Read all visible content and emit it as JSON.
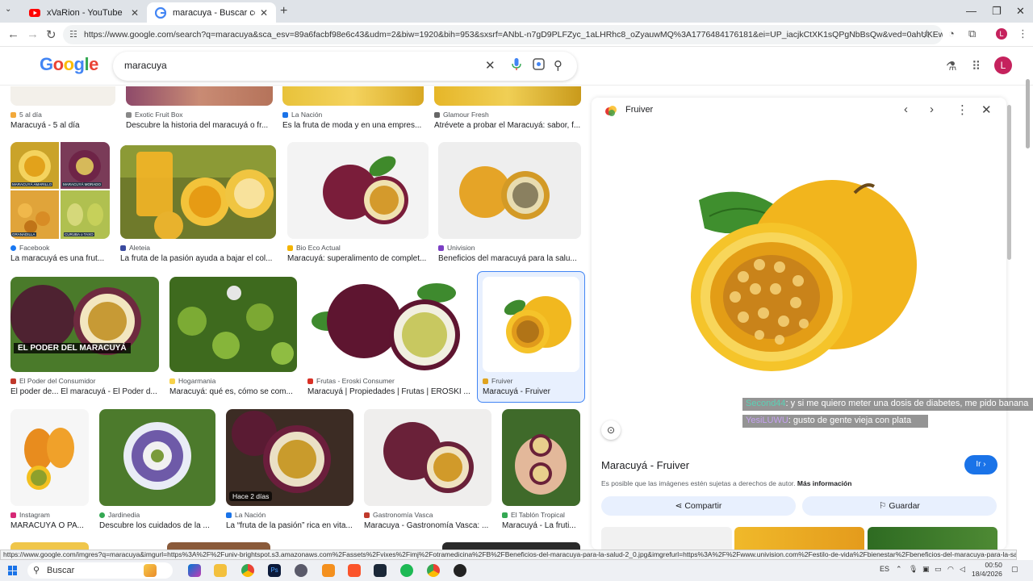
{
  "browser": {
    "tabs": [
      {
        "title": "xVaRion - YouTube",
        "active": false
      },
      {
        "title": "maracuya - Buscar con Google",
        "active": true
      }
    ],
    "new_tab": "+",
    "url": "https://www.google.com/search?q=maracuya&sca_esv=89a6facbf98e6c43&udm=2&biw=1920&bih=953&sxsrf=ANbL-n7gD9PLFZyc_1aLHRhc8_oZyauwMQ%3A1776484176181&ei=UP_iacjkCtXK1sQPgNbBsQw&ved=0ahUKEwjIzJSiv_aTAxVVpZUCH...",
    "profile_letter": "L"
  },
  "google": {
    "search_query": "maracuya",
    "avatar_letter": "L"
  },
  "results": [
    {
      "source": "5 al día",
      "caption": "Maracuyá - 5 al día",
      "color": "#f2a93b"
    },
    {
      "source": "Exotic Fruit Box",
      "caption": "Descubre la historia del maracuyá o fr...",
      "color": "#888"
    },
    {
      "source": "La Nación",
      "caption": "Es la fruta de moda y en una empres...",
      "color": "#1a73e8"
    },
    {
      "source": "Glamour Fresh",
      "caption": "Atrévete a probar el Maracuyá: sabor, f...",
      "color": "#666"
    },
    {
      "source": "Facebook",
      "caption": "La maracuyá es una frut...",
      "color": "#1877f2"
    },
    {
      "source": "Aleteia",
      "caption": "La fruta de la pasión ayuda a bajar el col...",
      "color": "#3a4a9f"
    },
    {
      "source": "Bio Eco Actual",
      "caption": "Maracuyá: superalimento de complet...",
      "color": "#f4b400"
    },
    {
      "source": "Univision",
      "caption": "Beneficios del maracuyá para la salu...",
      "color": "#7b3fc4"
    },
    {
      "source": "El Poder del Consumidor",
      "caption": "El poder de... El maracuyá - El Poder d...",
      "color": "#c0392b"
    },
    {
      "source": "Hogarmania",
      "caption": "Maracuyá: qué es, cómo se com...",
      "color": "#f7d24a"
    },
    {
      "source": "Frutas - Eroski Consumer",
      "caption": "Maracuyá | Propiedades | Frutas | EROSKI ...",
      "color": "#d93025"
    },
    {
      "source": "Fruiver",
      "caption": "Maracuyá - Fruiver",
      "color": "#e0a420"
    },
    {
      "source": "Instagram",
      "caption": "MARACUYÁ O PA...",
      "color": "#d62976"
    },
    {
      "source": "Jardinedia",
      "caption": "Descubre los cuidados de la ...",
      "color": "#34a853"
    },
    {
      "source": "La Nación",
      "caption": "La “fruta de la pasión” rica en vita...",
      "color": "#1a73e8"
    },
    {
      "source": "Gastronomía Vasca",
      "caption": "Maracuya - Gastronomía Vasca: ...",
      "color": "#c0392b"
    },
    {
      "source": "El Tablón Tropical",
      "caption": "Maracuyá - La fruti...",
      "color": "#34a853"
    }
  ],
  "overlays": {
    "facebook_img_labels": [
      "MARACUYÁ AMARILLO",
      "MARACUYÁ MORADO",
      "GRANADILLA",
      "CURUBA o TAXO"
    ],
    "poder_label": "EL PODER DEL MARACUYÁ",
    "time_badge": "Hace 2 días"
  },
  "panel": {
    "source": "Fruiver",
    "title": "Maracuyá - Fruiver",
    "go_label": "Ir",
    "copyright": "Es posible que las imágenes estén sujetas a derechos de autor.",
    "more_info": "Más información",
    "share_label": "Compartir",
    "save_label": "Guardar"
  },
  "chat": [
    {
      "user": "Second44",
      "msg": ": y si me quiero meter una dosis de diabetes, me pido banana"
    },
    {
      "user": "YesiLUWU",
      "msg": ": gusto de gente vieja con plata"
    }
  ],
  "status_url": "https://www.google.com/imgres?q=maracuya&imgurl=https%3A%2F%2Funiv-brightspot.s3.amazonaws.com%2Fassets%2Fvixes%2Fimj%2Fotramedicina%2FB%2FBeneficios-del-maracuya-para-la-salud-2_0.jpg&imgrefurl=https%3A%2F%2Fwww.univision.com%2Festilo-de-vida%2Fbienestar%2Fbeneficios-del-maracuya-para-la-salud&docid=Mhe3wgRO...",
  "taskbar": {
    "search_label": "Buscar",
    "lang": "ES",
    "time": "00:50",
    "date": "18/4/2026"
  }
}
